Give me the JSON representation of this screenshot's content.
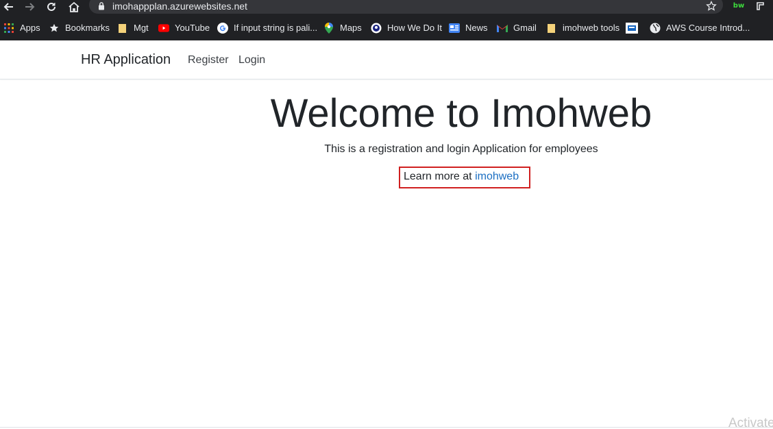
{
  "browser": {
    "url": "imohappplan.azurewebsites.net",
    "extension_label": "bw"
  },
  "bookmarks": [
    {
      "label": "Apps",
      "icon": "apps-grid-icon"
    },
    {
      "label": "Bookmarks",
      "icon": "star-icon"
    },
    {
      "label": "Mgt",
      "icon": "folder-icon"
    },
    {
      "label": "YouTube",
      "icon": "youtube-icon"
    },
    {
      "label": "If input string is pali...",
      "icon": "google-icon"
    },
    {
      "label": "Maps",
      "icon": "maps-pin-icon"
    },
    {
      "label": "How We Do It",
      "icon": "site-logo-icon"
    },
    {
      "label": "News",
      "icon": "news-icon"
    },
    {
      "label": "Gmail",
      "icon": "gmail-icon"
    },
    {
      "label": "imohweb tools",
      "icon": "folder-icon"
    },
    {
      "label": "",
      "icon": "favicon-icon"
    },
    {
      "label": "AWS Course Introd...",
      "icon": "globe-icon"
    }
  ],
  "navbar": {
    "brand": "HR Application",
    "links": [
      "Register",
      "Login"
    ]
  },
  "hero": {
    "title": "Welcome to Imohweb",
    "subtitle": "This is a registration and login Application for employees",
    "learn_prefix": "Learn more at ",
    "learn_link": "imohweb"
  },
  "watermark": "Activate",
  "colors": {
    "chrome_bg": "#202124",
    "link": "#1b6ec2",
    "highlight_border": "#d01f1f"
  }
}
